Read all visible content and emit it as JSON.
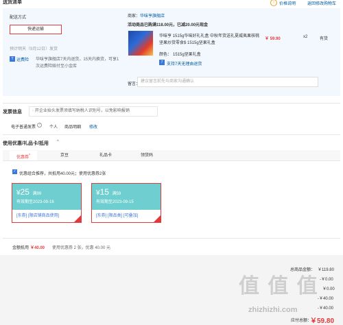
{
  "header": {
    "title": "送货清单",
    "price_note": "价格说明",
    "back_cart": "返回修改购物车"
  },
  "delivery": {
    "label": "配送方式",
    "method": "快递运输",
    "date_label": "预计明天（9月12日）发货",
    "return_badge": "运费险",
    "return_text": "华味亨旗舰店7天内退货，15天内换货，可享1次运费险赔付至小金库"
  },
  "shop": {
    "seller_label": "商家：",
    "seller_name": "华味亨旗舰店",
    "promo": "活动商品已购满118.00元，已减20.00元现金",
    "product_name": "华味亨 1515g华味好礼礼盒 中秋年货送礼夏威夷果核桃坚果炒货零食$ 1515g坚果礼盒",
    "price": "￥ 59.90",
    "qty": "x2",
    "stock": "有货",
    "color_label": "颜色：",
    "color_value": "1515g坚果礼盒",
    "support": "支持7天无理由退货",
    "note_label": "留言：",
    "note_placeholder": "建议留言前先与商家沟通确认"
  },
  "invoice": {
    "title": "发票信息",
    "tip": "开企业抬头发票须填写纳税人识别号，以免影响报销",
    "type_label": "电子普通发票",
    "type_help": "?",
    "personal": "个人",
    "detail": "商品明细",
    "edit": "修改"
  },
  "coupons": {
    "title": "使用优惠/礼品卡/抵用",
    "caret": "^",
    "tabs": [
      "优惠券",
      "京豆",
      "礼品卡",
      "领货码"
    ],
    "tab_badge": "*",
    "combo_text": "优惠组合推荐，共抵用40.00元；使用优惠券2张",
    "check_mark": "✓",
    "items": [
      {
        "symbol": "¥",
        "amount": "25",
        "unit": "满99",
        "validity": "有效期至2023-09-16",
        "tags": "[东券]  [限店铺商品使用]"
      },
      {
        "symbol": "¥",
        "amount": "15",
        "unit": "满59",
        "validity": "有效期至2023-09-15",
        "tags": "[东券]  [限品类]  [可叠加]"
      }
    ],
    "used_label": "金额抵用",
    "used_amount": "￥40.00",
    "used_detail": "使用优惠券 2 张，优惠 40.00 元"
  },
  "summary": {
    "total_label": "总商品金额：",
    "total_value": "￥119.80",
    "line2": "-￥0.00",
    "line3": "￥0.00",
    "line4": "-￥40.00",
    "line5": "-￥40.00",
    "pay_label": "应付总额：",
    "pay_value": "￥59.80"
  },
  "watermark": {
    "text": "值 值 值",
    "url": "zhizhizhi.com"
  }
}
